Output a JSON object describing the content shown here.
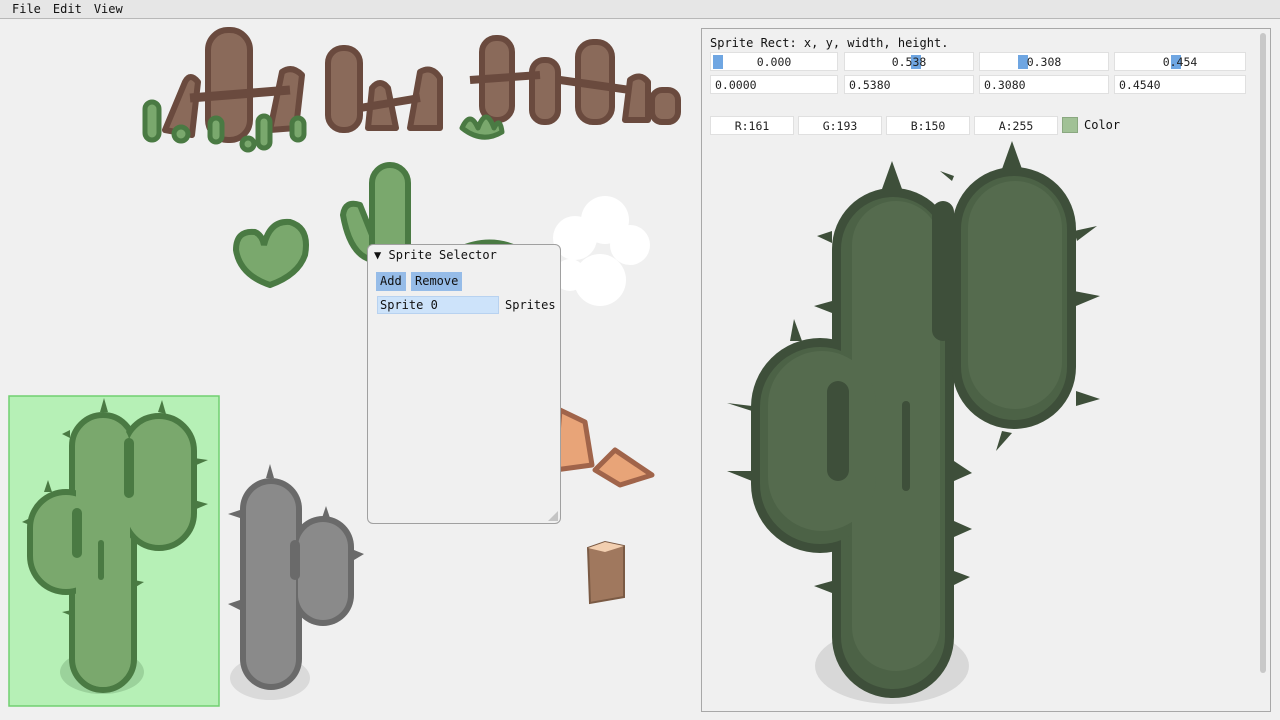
{
  "menu": [
    "File",
    "Edit",
    "View"
  ],
  "sprite_rect": {
    "label": "Sprite Rect: x, y, width, height.",
    "slider_values": [
      "0.000",
      "0.538",
      "0.308",
      "0.454"
    ],
    "field_values": [
      "0.0000",
      "0.5380",
      "0.3080",
      "0.4540"
    ]
  },
  "color": {
    "r": "R:161",
    "g": "G:193",
    "b": "B:150",
    "a": "A:255",
    "label": "Color",
    "swatch": "#a1c196"
  },
  "selector": {
    "title": "Sprite Selector",
    "toggle_icon": "triangle-down-icon",
    "add_label": "Add",
    "remove_label": "Remove",
    "items": [
      "Sprite 0"
    ],
    "list_label": "Sprites"
  },
  "colors": {
    "cactus_light": "#7aa86d",
    "cactus_dark": "#4a7a43",
    "cactus_preview": "#556b4e",
    "cactus_preview_outline": "#3e4f3a",
    "fence_brown": "#8a6a5a",
    "fence_outline": "#6a4a3e",
    "selection_fill": "#b6f0b6",
    "selection_border": "#70d070",
    "gray_cactus": "#8a8a8a",
    "gray_cactus_dark": "#6a6a6a"
  }
}
